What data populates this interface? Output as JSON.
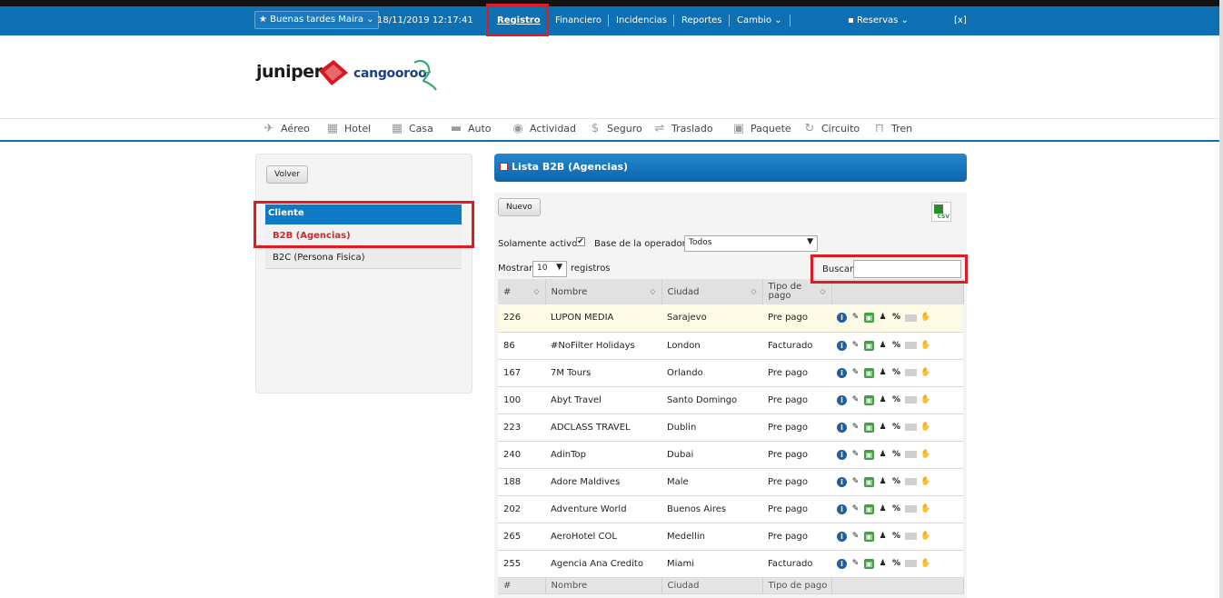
{
  "topbar": {
    "greeting": "Buenas tardes Maira",
    "datetime": "18/11/2019 12:17:41",
    "nav": [
      "Registro",
      "Financiero",
      "Incidencias",
      "Reportes",
      "Cambio"
    ],
    "reservas": "Reservas",
    "logout": "[x]"
  },
  "logo": {
    "juniper": "juniper",
    "cangooroo": "cangooroo"
  },
  "services": [
    {
      "label": "Aéreo",
      "icon": "plane-icon"
    },
    {
      "label": "Hotel",
      "icon": "hotel-icon"
    },
    {
      "label": "Casa",
      "icon": "house-icon"
    },
    {
      "label": "Auto",
      "icon": "car-icon"
    },
    {
      "label": "Actividad",
      "icon": "activity-icon"
    },
    {
      "label": "Seguro",
      "icon": "dollar-icon"
    },
    {
      "label": "Traslado",
      "icon": "transfer-icon"
    },
    {
      "label": "Paquete",
      "icon": "suitcase-icon"
    },
    {
      "label": "Circuito",
      "icon": "circuit-icon"
    },
    {
      "label": "Tren",
      "icon": "train-icon"
    }
  ],
  "sidebar": {
    "back": "Volver",
    "section": "Cliente",
    "items": [
      "B2B (Agencias)",
      "B2C (Persona Fisica)"
    ]
  },
  "panel": {
    "title": "Lista B2B (Agencias)",
    "new_button": "Nuevo",
    "csv_label": "CSV",
    "only_active": "Solamente activos",
    "check": "✔",
    "operator_base_label": "Base de la operadora",
    "operator_base_value": "Todos",
    "show": "Mostrar",
    "page_size": "10",
    "records": "registros",
    "search_label": "Buscar",
    "search_value": ""
  },
  "table": {
    "headers": [
      "#",
      "Nombre",
      "Ciudad",
      "Tipo de pago"
    ],
    "rows": [
      {
        "id": "226",
        "name": "LUPON MEDIA",
        "city": "Sarajevo",
        "payment": "Pre pago"
      },
      {
        "id": "86",
        "name": "#NoFilter Holidays",
        "city": "London",
        "payment": "Facturado"
      },
      {
        "id": "167",
        "name": "7M Tours",
        "city": "Orlando",
        "payment": "Pre pago"
      },
      {
        "id": "100",
        "name": "Abyt Travel",
        "city": "Santo Domingo",
        "payment": "Pre pago"
      },
      {
        "id": "223",
        "name": "ADCLASS TRAVEL",
        "city": "Dublin",
        "payment": "Pre pago"
      },
      {
        "id": "240",
        "name": "AdinTop",
        "city": "Dubai",
        "payment": "Pre pago"
      },
      {
        "id": "188",
        "name": "Adore Maldives",
        "city": "Male",
        "payment": "Pre pago"
      },
      {
        "id": "202",
        "name": "Adventure World",
        "city": "Buenos Aires",
        "payment": "Pre pago"
      },
      {
        "id": "265",
        "name": "AeroHotel COL",
        "city": "Medellin",
        "payment": "Pre pago"
      },
      {
        "id": "255",
        "name": "Agencia Ana Credito",
        "city": "Miami",
        "payment": "Facturado"
      }
    ]
  },
  "colors": {
    "brand_blue": "#0e6fb3",
    "highlight_red": "#e01b24",
    "active_red": "#d1282c"
  }
}
